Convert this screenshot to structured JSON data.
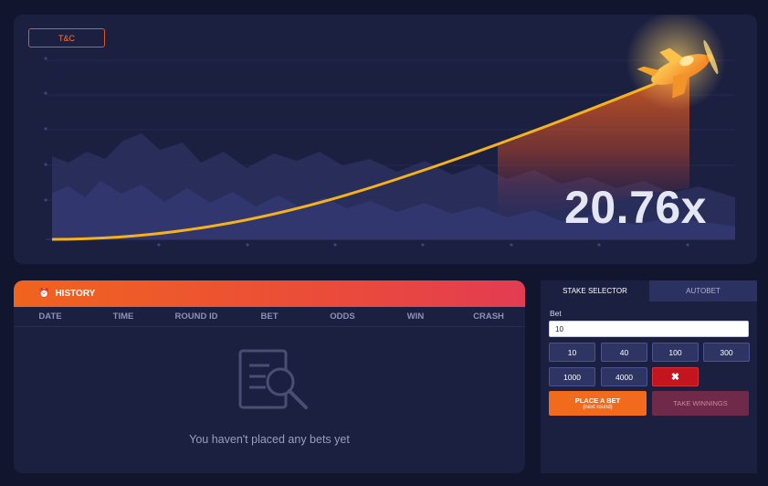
{
  "game": {
    "tc_label": "T&C",
    "multiplier": "20.76x",
    "plane_icon": "plane-icon",
    "colors": {
      "curve": "#f5b21c",
      "fill": "#e8641a",
      "panel": "#1b1f40"
    }
  },
  "history": {
    "title": "HISTORY",
    "icon": "clock-icon",
    "columns": [
      "DATE",
      "TIME",
      "ROUND ID",
      "BET",
      "ODDS",
      "WIN",
      "CRASH"
    ],
    "empty_icon": "document-search-icon",
    "empty_message": "You haven't placed any bets yet"
  },
  "stake": {
    "tabs": [
      {
        "label": "STAKE SELECTOR",
        "active": true
      },
      {
        "label": "AUTOBET",
        "active": false
      }
    ],
    "bet_label": "Bet",
    "bet_value": "10",
    "chips": [
      "10",
      "40",
      "100",
      "300",
      "1000",
      "4000"
    ],
    "clear_icon": "close-icon",
    "clear_symbol": "✖",
    "place_bet": {
      "label": "PLACE A BET",
      "sublabel": "(next round)"
    },
    "take_winnings": "TAKE WINNINGS",
    "colors": {
      "place": "#f26a1b",
      "take": "#6e2a48",
      "clear": "#c4141e"
    }
  }
}
